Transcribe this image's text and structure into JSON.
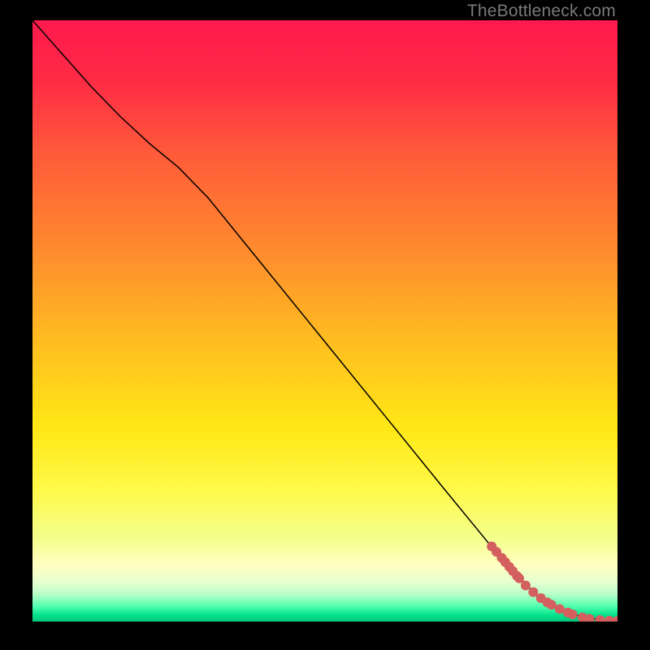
{
  "watermark": "TheBottleneck.com",
  "chart_data": {
    "type": "line",
    "title": "",
    "xlabel": "",
    "ylabel": "",
    "xlim": [
      0,
      100
    ],
    "ylim": [
      0,
      100
    ],
    "background_gradient": {
      "stops": [
        {
          "offset": 0.0,
          "color": "#ff1a4d"
        },
        {
          "offset": 0.1,
          "color": "#ff2b45"
        },
        {
          "offset": 0.22,
          "color": "#ff5a3a"
        },
        {
          "offset": 0.38,
          "color": "#ff8a2e"
        },
        {
          "offset": 0.55,
          "color": "#ffc21f"
        },
        {
          "offset": 0.68,
          "color": "#ffe815"
        },
        {
          "offset": 0.78,
          "color": "#fff94a"
        },
        {
          "offset": 0.86,
          "color": "#f4ff8a"
        },
        {
          "offset": 0.905,
          "color": "#ffffc0"
        },
        {
          "offset": 0.935,
          "color": "#e6ffd0"
        },
        {
          "offset": 0.955,
          "color": "#b6ffc8"
        },
        {
          "offset": 0.975,
          "color": "#4fffad"
        },
        {
          "offset": 0.99,
          "color": "#00e08a"
        },
        {
          "offset": 1.0,
          "color": "#00c87a"
        }
      ]
    },
    "series": [
      {
        "name": "curve",
        "mode": "line",
        "color": "#000000",
        "width": 1.5,
        "x": [
          0,
          5,
          10,
          15,
          20,
          25,
          30,
          40,
          50,
          60,
          70,
          78,
          83,
          86,
          88,
          90,
          92,
          94,
          96,
          98,
          100
        ],
        "y": [
          100,
          94.5,
          89,
          84,
          79.5,
          75.5,
          70.5,
          58.5,
          46.5,
          34.5,
          22.5,
          13,
          7.5,
          4.5,
          3,
          2,
          1.3,
          0.8,
          0.45,
          0.25,
          0.15
        ]
      },
      {
        "name": "points",
        "mode": "markers",
        "color": "#d45f5f",
        "radius": 6,
        "x": [
          78.5,
          79.3,
          80.2,
          80.8,
          81.5,
          82.1,
          82.8,
          83.2,
          84.3,
          85.6,
          86.9,
          88.0,
          88.7,
          90.1,
          91.5,
          92.3,
          94.0,
          95.2,
          97.0,
          98.6,
          100.0
        ],
        "y": [
          12.5,
          11.6,
          10.6,
          9.9,
          9.1,
          8.4,
          7.6,
          7.2,
          6.0,
          4.9,
          3.9,
          3.2,
          2.8,
          2.1,
          1.5,
          1.2,
          0.7,
          0.45,
          0.25,
          0.15,
          0.1
        ]
      }
    ]
  }
}
